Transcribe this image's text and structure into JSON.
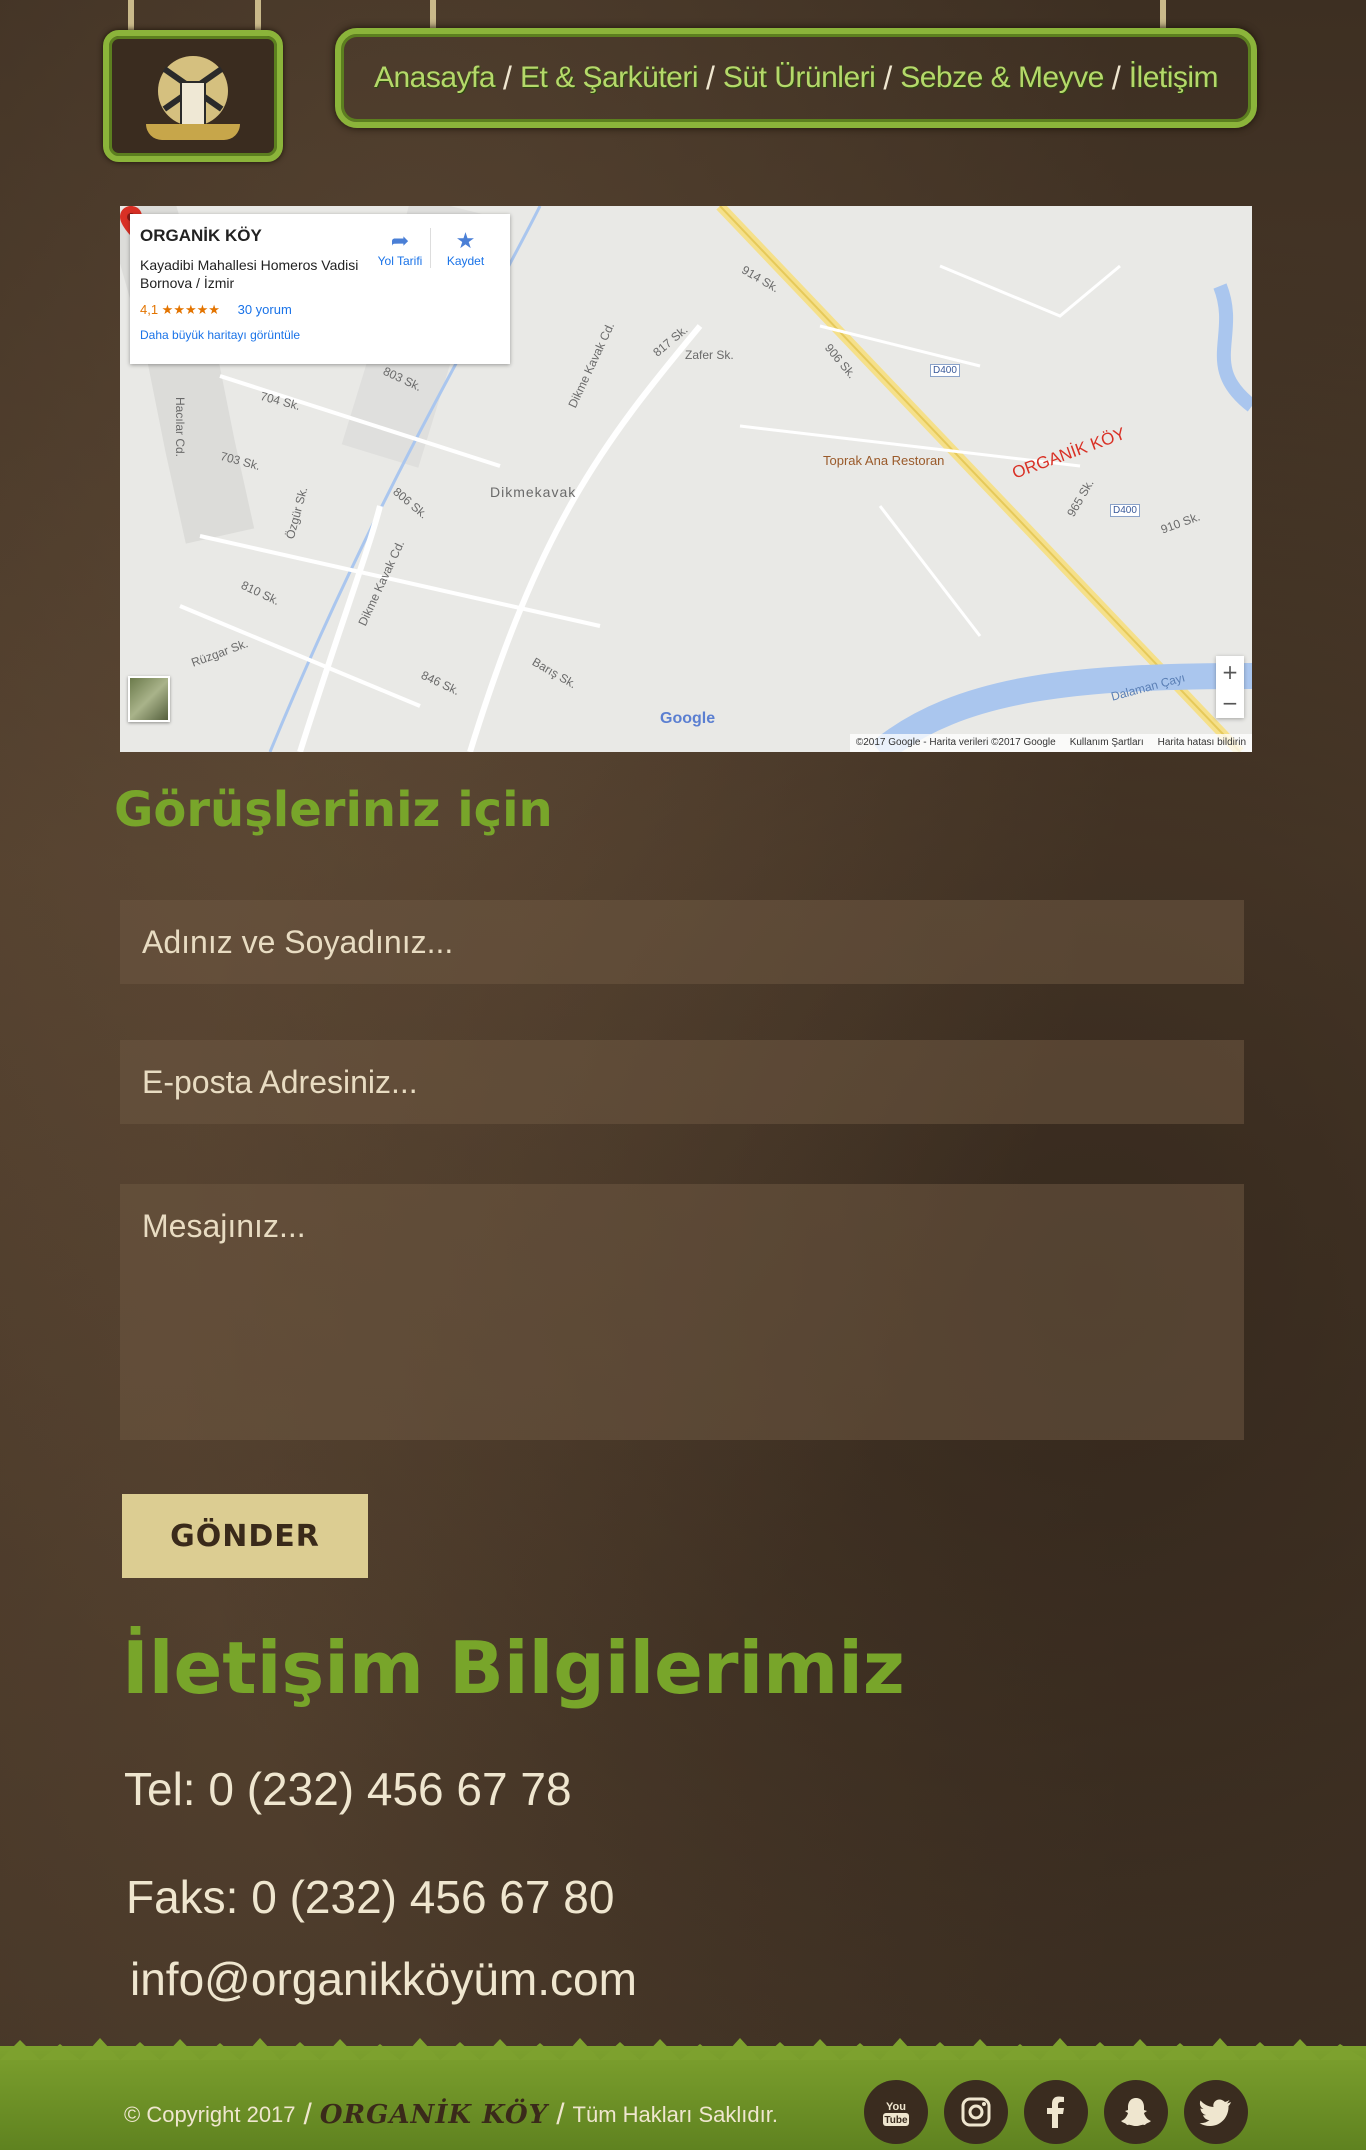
{
  "nav": {
    "items": [
      "Anasayfa",
      "Et & Şarküteri",
      "Süt Ürünleri",
      "Sebze & Meyve",
      "İletişim"
    ],
    "separator": "/"
  },
  "map": {
    "place_title": "ORGANİK KÖY",
    "address": "Kayadibi Mahallesi Homeros Vadisi Bornova / İzmir",
    "rating": "4,1 ★★★★★",
    "reviews": "30 yorum",
    "bigger_map_link": "Daha büyük haritayı görüntüle",
    "directions_label": "Yol Tarifi",
    "save_label": "Kaydet",
    "pin_label": "ORGANİK KÖY",
    "restaurant_label": "Toprak Ana Restoran",
    "area_label": "Dikmekavak",
    "google": "Google",
    "footer_copyright": "©2017 Google - Harita verileri ©2017 Google",
    "footer_terms": "Kullanım Şartları",
    "footer_report": "Harita hatası bildirin",
    "zoom_in": "+",
    "zoom_out": "−",
    "street_labels": {
      "cd1": "Dikme Kavak Cd.",
      "cd2": "Dikme Kavak Cd.",
      "haclar": "Hacılar Cd.",
      "ozgur": "Özgür Sk.",
      "ruzgar": "Rüzgar Sk.",
      "zafer": "Zafer Sk.",
      "s803": "803 Sk.",
      "s810": "810 Sk.",
      "s846": "846 Sk.",
      "s806": "806 Sk.",
      "s703": "703 Sk.",
      "s704": "704 Sk.",
      "s906": "906 Sk.",
      "s965": "965 Sk.",
      "s910": "910 Sk.",
      "d400a": "D400",
      "d400b": "D400",
      "dalaman": "Dalaman Çayı",
      "baris": "Barış Sk.",
      "s817": "817 Sk.",
      "s914": "914 Sk."
    }
  },
  "form": {
    "title": "Görüşleriniz için",
    "name_placeholder": "Adınız ve Soyadınız...",
    "email_placeholder": "E-posta Adresiniz...",
    "message_placeholder": "Mesajınız...",
    "submit_label": "GÖNDER"
  },
  "contact": {
    "title": "İletişim Bilgilerimiz",
    "tel": "Tel: 0 (232) 456 67 78",
    "fax": "Faks: 0 (232) 456 67 80",
    "email": "info@organikköyüm.com"
  },
  "footer": {
    "copyright": "© Copyright  2017",
    "brand": "ORGANİK KÖY",
    "rights": "Tüm Hakları Saklıdır.",
    "separator": "/",
    "social": [
      "youtube-icon",
      "instagram-icon",
      "facebook-icon",
      "snapchat-icon",
      "twitter-icon"
    ]
  },
  "colors": {
    "accent_green": "#78a52a",
    "nav_green": "#b5d86a",
    "button_bg": "#dccd92",
    "background": "#4a3a2a"
  }
}
